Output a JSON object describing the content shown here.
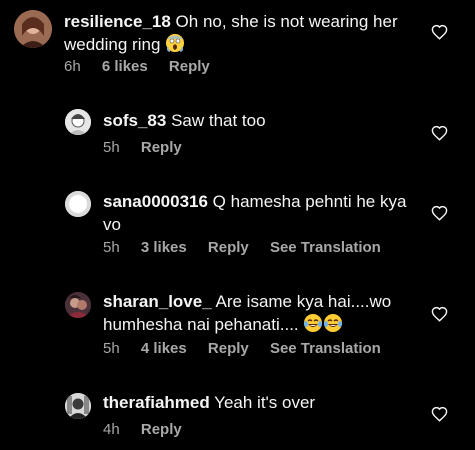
{
  "comments": [
    {
      "username": "resilience_18",
      "text": "Oh no, she is not wearing her wedding ring",
      "emoji": [
        "scream-face"
      ],
      "time": "6h",
      "likes": "6 likes",
      "reply_label": "Reply",
      "is_reply": false
    },
    {
      "username": "sofs_83",
      "text": "Saw that too",
      "time": "5h",
      "reply_label": "Reply",
      "is_reply": true
    },
    {
      "username": "sana0000316",
      "text": "Q hamesha pehnti he kya vo",
      "time": "5h",
      "likes": "3 likes",
      "reply_label": "Reply",
      "translation_label": "See Translation",
      "is_reply": true
    },
    {
      "username": "sharan_love_",
      "text": "Are isame kya hai....wo humhesha nai pehanati....",
      "emoji": [
        "joy-face",
        "joy-face"
      ],
      "time": "5h",
      "likes": "4 likes",
      "reply_label": "Reply",
      "translation_label": "See Translation",
      "is_reply": true
    },
    {
      "username": "therafiahmed",
      "text": "Yeah it's over",
      "time": "4h",
      "reply_label": "Reply",
      "is_reply": true
    }
  ],
  "colors": {
    "background": "#000000",
    "primary_text": "#f5f5f5",
    "secondary_text": "#a8a8a8"
  }
}
